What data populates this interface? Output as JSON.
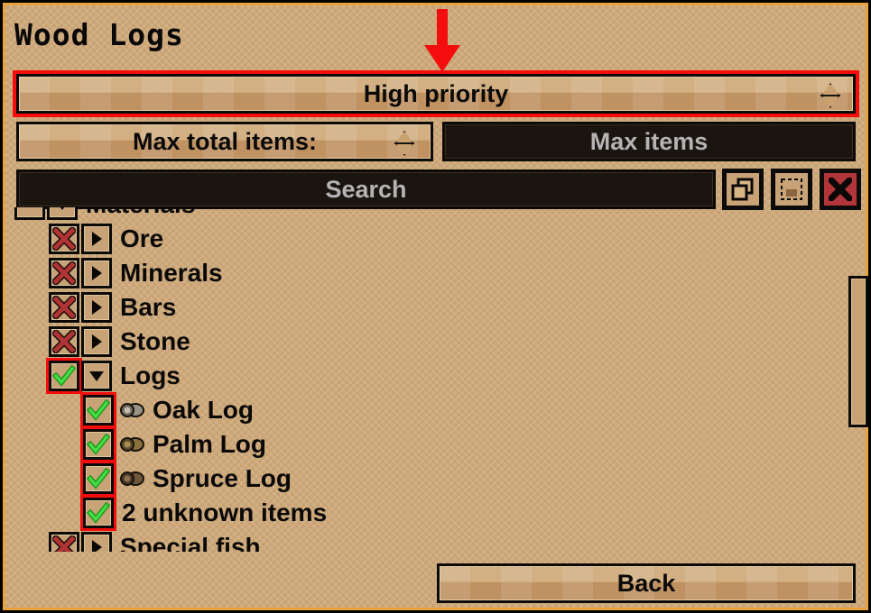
{
  "window": {
    "title": "Wood Logs",
    "frame_color": "#e8a33d",
    "background_color": "#c8a376"
  },
  "annotation": {
    "arrow": "red-down-arrow",
    "arrow_color": "#f40d0d",
    "target": "priority-dropdown",
    "highlight_color": "#f40d0d"
  },
  "priority_dropdown": {
    "label": "High priority",
    "spinner_icon": "spinner-diamond-icon",
    "highlighted": "true"
  },
  "max_total": {
    "label": "Max total items:",
    "spinner_icon": "spinner-diamond-icon"
  },
  "max_items_field": {
    "placeholder": "Max items",
    "value": ""
  },
  "search": {
    "placeholder": "Search",
    "value": "",
    "buttons": [
      {
        "icon": "copy-icon",
        "name": "copy-button"
      },
      {
        "icon": "paste-icon",
        "name": "paste-button"
      },
      {
        "icon": "close-x-icon",
        "name": "clear-button"
      }
    ]
  },
  "tree": {
    "rows": [
      {
        "label": "Materials",
        "state": "partial",
        "expander": "down",
        "indent": 0,
        "sprite": null,
        "selected": false,
        "clipped": "top"
      },
      {
        "label": "Ore",
        "state": "unchecked",
        "expander": "right",
        "indent": 1,
        "sprite": null,
        "selected": false
      },
      {
        "label": "Minerals",
        "state": "unchecked",
        "expander": "right",
        "indent": 1,
        "sprite": null,
        "selected": false
      },
      {
        "label": "Bars",
        "state": "unchecked",
        "expander": "right",
        "indent": 1,
        "sprite": null,
        "selected": false
      },
      {
        "label": "Stone",
        "state": "unchecked",
        "expander": "right",
        "indent": 1,
        "sprite": null,
        "selected": false
      },
      {
        "label": "Logs",
        "state": "checked",
        "expander": "down",
        "indent": 1,
        "sprite": null,
        "selected": true
      },
      {
        "label": "Oak Log",
        "state": "checked",
        "expander": null,
        "indent": 2,
        "sprite": "oak-log-icon",
        "selected": true
      },
      {
        "label": "Palm Log",
        "state": "checked",
        "expander": null,
        "indent": 2,
        "sprite": "palm-log-icon",
        "selected": true
      },
      {
        "label": "Spruce Log",
        "state": "checked",
        "expander": null,
        "indent": 2,
        "sprite": "spruce-log-icon",
        "selected": true
      },
      {
        "label": "2 unknown items",
        "state": "checked",
        "expander": null,
        "indent": 2,
        "sprite": null,
        "selected": true
      },
      {
        "label": "Special fish",
        "state": "unchecked",
        "expander": "right",
        "indent": 1,
        "sprite": null,
        "selected": false,
        "clipped": "bottom"
      }
    ]
  },
  "scrollbar": {
    "orientation": "vertical",
    "thumb_position_pct": 18
  },
  "footer": {
    "back_label": "Back"
  }
}
